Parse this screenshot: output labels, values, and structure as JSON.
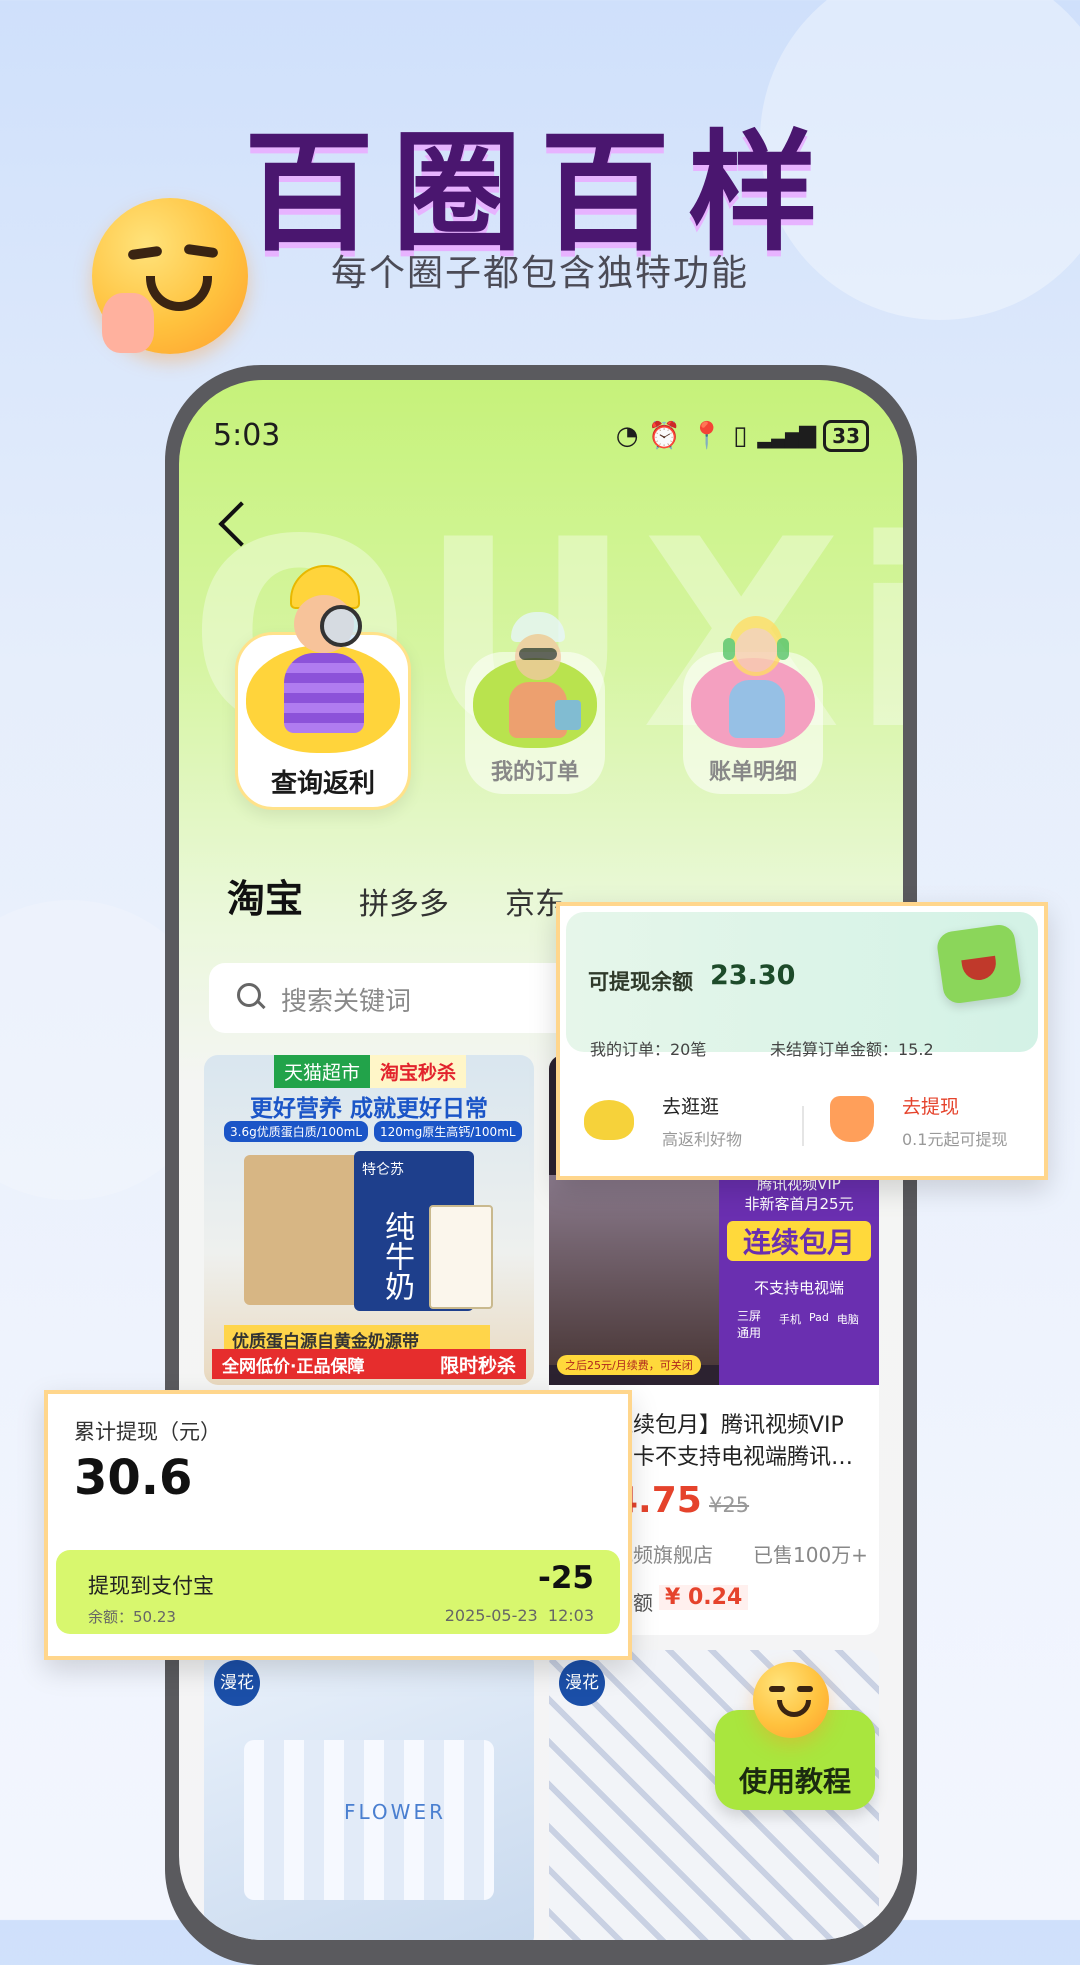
{
  "header": {
    "title": "百圈百样",
    "subtitle": "每个圈子都包含独特功能"
  },
  "statusbar": {
    "time": "5:03",
    "battery": "33"
  },
  "features": [
    {
      "label": "查询返利"
    },
    {
      "label": "我的订单"
    },
    {
      "label": "账单明细"
    }
  ],
  "tabs": [
    "淘宝",
    "拼多多",
    "京东"
  ],
  "search": {
    "placeholder": "搜索关键词"
  },
  "product_left_top": {
    "badge1": "天猫超市",
    "badge2": "淘宝秒杀",
    "headline": "更好营养 成就更好日常",
    "spec1": "3.6g优质蛋白质/100mL",
    "spec2": "120mg原生高钙/100mL",
    "box_text": "纯牛奶",
    "brand": "特仑苏",
    "band1": "优质蛋白源自黄金奶源带",
    "band2": "全网低价·正品保障",
    "band3": "限时秒杀"
  },
  "product_right_top": {
    "promo_line1": "腾讯视频VIP",
    "promo_line2": "非新客首月25元",
    "promo_big": "连续包月",
    "promo_small": "不支持电视端",
    "screens_label": "三屏通用",
    "devices": [
      "手机",
      "Pad",
      "电脑"
    ],
    "footnote": "之后25元/月续费，可关闭",
    "title": "连续包月】腾讯视频VIP",
    "title2": "月卡不支持电视端腾讯…",
    "price": "4.75",
    "orig_price": "¥25",
    "shop": "视频旗舰店",
    "sold": "已售100万+",
    "rebate_label": "金额",
    "rebate_value": "¥ 0.24"
  },
  "balance_card": {
    "label": "可提现余额",
    "amount": "23.30",
    "orders": "我的订单：20笔",
    "pending": "未结算订单金额：15.2",
    "action1_title": "去逛逛",
    "action1_sub": "高返利好物",
    "action2_title": "去提现",
    "action2_sub": "0.1元起可提现"
  },
  "withdraw_card": {
    "label": "累计提现（元）",
    "total": "30.6",
    "row_title": "提现到支付宝",
    "row_amount": "-25",
    "row_balance": "余额：50.23",
    "row_date": "2025-05-23  12:03"
  },
  "bottom_products": {
    "brand_left": "漫花",
    "brand_right": "漫花",
    "flower_text": "FLOWER"
  },
  "tutorial": {
    "label": "使用教程"
  },
  "colors": {
    "title": "#4a166f",
    "accent_green": "#c9f55e",
    "price_red": "#e5432c",
    "card_border": "#ffd68c"
  }
}
